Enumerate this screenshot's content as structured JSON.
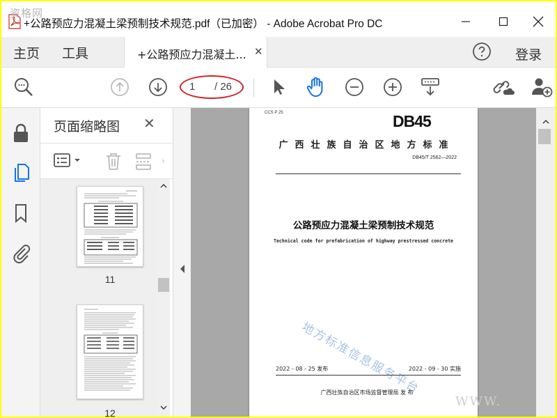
{
  "window": {
    "title": "+公路预应力混凝土梁预制技术规范.pdf（已加密） - Adobe Acrobat Pro DC",
    "watermark": "资格网"
  },
  "menu": {
    "home": "主页",
    "tools": "工具",
    "doc_tab": "+公路预应力混凝土...",
    "login": "登录"
  },
  "toolbar": {
    "current_page": "1",
    "total_pages": "/ 26",
    "highlight_color": "#d42020"
  },
  "thumbnails": {
    "title": "页面缩略图",
    "items": [
      {
        "label": "11"
      },
      {
        "label": "12"
      }
    ]
  },
  "page": {
    "ccs": "CCS P 25",
    "db_code": "DB45",
    "standard_type": "广西壮族自治区地方标准",
    "standard_number": "DB45/T 2562—2022",
    "title_cn": "公路预应力混凝土梁预制技术规范",
    "title_en": "Technical code for prefabrication of highway prestressed concrete",
    "watermark": "地方标准信息服务平台",
    "issue_date": "2022 - 08 - 25 发布",
    "impl_date": "2022 - 09 - 30 实施",
    "issuer": "广西壮族自治区市场监督管理局    发  布"
  },
  "corner_watermark": "WWW.",
  "colors": {
    "accent_blue": "#1473e6",
    "border_yellow": "#ffff00",
    "viewport_gray": "#a8a8a8"
  }
}
